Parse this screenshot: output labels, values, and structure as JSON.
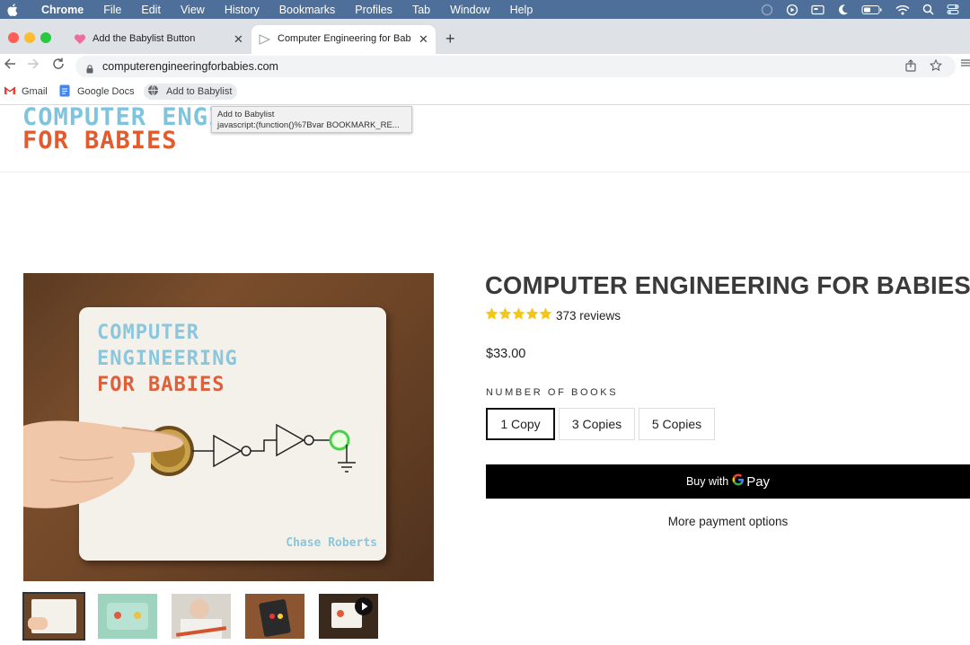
{
  "menubar": {
    "app": "Chrome",
    "items": [
      "File",
      "Edit",
      "View",
      "History",
      "Bookmarks",
      "Profiles",
      "Tab",
      "Window",
      "Help"
    ]
  },
  "tabs": [
    {
      "title": "Add the Babylist Button",
      "icon": "heart-icon"
    },
    {
      "title": "Computer Engineering for Bab",
      "icon": "loading-play-icon"
    }
  ],
  "toolbar": {
    "url": "computerengineeringforbabies.com"
  },
  "bookmarks": [
    "Gmail",
    "Google Docs",
    "Add to Babylist"
  ],
  "tooltip": {
    "line1": "Add to Babylist",
    "line2": "javascript:(function()%7Bvar BOOKMARK_RE..."
  },
  "site": {
    "logo_line1": "COMPUTER ENGI",
    "logo_line2": "FOR BABIES"
  },
  "product": {
    "image_text": {
      "line1": "COMPUTER",
      "line2": "ENGINEERING",
      "line3": "FOR BABIES",
      "author": "Chase Roberts"
    },
    "title": "COMPUTER ENGINEERING FOR BABIES",
    "rating": 5,
    "reviews": "373 reviews",
    "price": "$33.00",
    "option_label": "NUMBER OF BOOKS",
    "options": [
      "1 Copy",
      "3 Copies",
      "5 Copies"
    ],
    "buy_label": "Buy with",
    "buy_brand": "Pay",
    "more_payment": "More payment options"
  },
  "colors": {
    "menubar": "#4d6f9a",
    "logo_blue": "#7fc4de",
    "logo_orange": "#e25a2e",
    "star": "#f5c518"
  }
}
